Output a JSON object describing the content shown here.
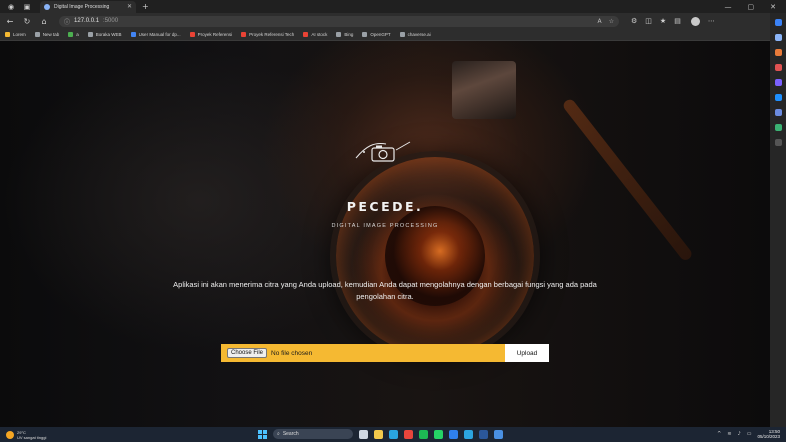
{
  "browser": {
    "tab_title": "Digital Image Processing",
    "url": "127.0.0.1",
    "url_port": ":5000",
    "bookmarks": [
      {
        "label": "Lorem",
        "color": "#f5b932"
      },
      {
        "label": "New tab",
        "color": "#9aa0a6"
      },
      {
        "label": "a",
        "color": "#4caf50"
      },
      {
        "label": "Boraka WEB",
        "color": "#9aa0a6"
      },
      {
        "label": "User Manual for dp...",
        "color": "#4285f4"
      },
      {
        "label": "Proyek Referensi",
        "color": "#ea4335"
      },
      {
        "label": "Proyek Referensi Tech",
        "color": "#ea4335"
      },
      {
        "label": "AI stock",
        "color": "#ea4335"
      },
      {
        "label": "Bing",
        "color": "#9aa0a6"
      },
      {
        "label": "OpenGPT",
        "color": "#9aa0a6"
      },
      {
        "label": "chaverse.ai",
        "color": "#9aa0a6"
      }
    ]
  },
  "hero": {
    "brand": "PECEDE.",
    "subtitle": "DIGITAL IMAGE PROCESSING",
    "description": "Aplikasi ini akan menerima citra yang Anda upload, kemudian Anda dapat mengolahnya dengan berbagai fungsi yang ada pada pengolahan citra."
  },
  "upload": {
    "choose_label": "Choose File",
    "no_file_text": "No file chosen",
    "submit_label": "Upload",
    "accent_color": "#f5b932"
  },
  "taskbar": {
    "weather_temp": "29°C",
    "weather_desc": "UV sangat tinggi",
    "search_placeholder": "Search",
    "time": "13:50",
    "date": "05/10/2023"
  }
}
